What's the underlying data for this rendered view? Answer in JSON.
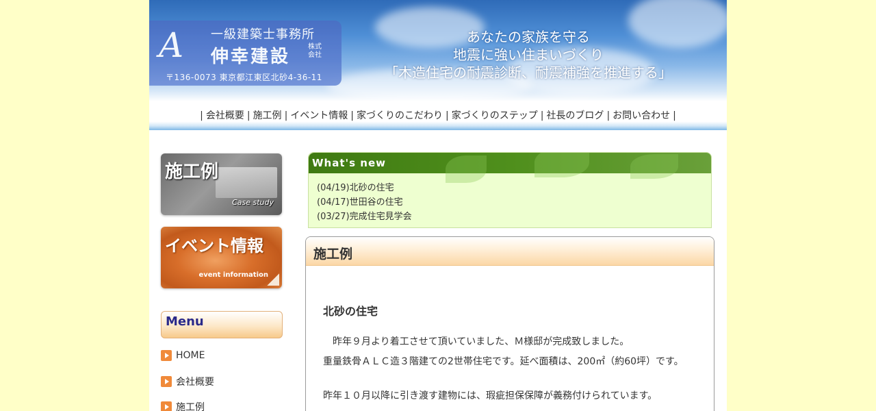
{
  "header": {
    "logo_mark": "A",
    "logo_line1": "一級建築士事務所",
    "logo_line2": "伸幸建設",
    "logo_kabu": "株式会社",
    "address": "〒136-0073 東京都江東区北砂4-36-11",
    "catch_line1": "あなたの家族を守る",
    "catch_line2": "地震に強い住まいづくり",
    "catch_line3": "「木造住宅の耐震診断、耐震補強を推進する」"
  },
  "nav": {
    "items": [
      "会社概要",
      "施工例",
      "イベント情報",
      "家づくりのこだわり",
      "家づくりのステップ",
      "社長のブログ",
      "お問い合わせ"
    ]
  },
  "sidebar": {
    "banner_case_title": "施工例",
    "banner_case_sub": "Case study",
    "banner_event_title": "イベント情報",
    "banner_event_sub": "event information",
    "menu_title": "Menu",
    "menu_items": [
      "HOME",
      "会社概要",
      "施工例"
    ]
  },
  "whats_new": {
    "title": "What's new",
    "items": [
      "(04/19)北砂の住宅",
      "(04/17)世田谷の住宅",
      "(03/27)完成住宅見学会"
    ]
  },
  "main": {
    "section_title": "施工例",
    "post_title": "北砂の住宅",
    "paragraphs": [
      "　昨年９月より着工させて頂いていました、Ｍ様邸が完成致しました。",
      "重量鉄骨ＡＬＣ造３階建ての2世帯住宅です。延べ面積は、200㎡（約60坪）です。",
      "昨年１０月以降に引き渡す建物には、瑕疵担保保障が義務付けられています。"
    ]
  },
  "colors": {
    "page_bg": "#ffffc8",
    "whats_new_green": "#4f8f1c",
    "menu_arrow": "#f08a3a"
  }
}
